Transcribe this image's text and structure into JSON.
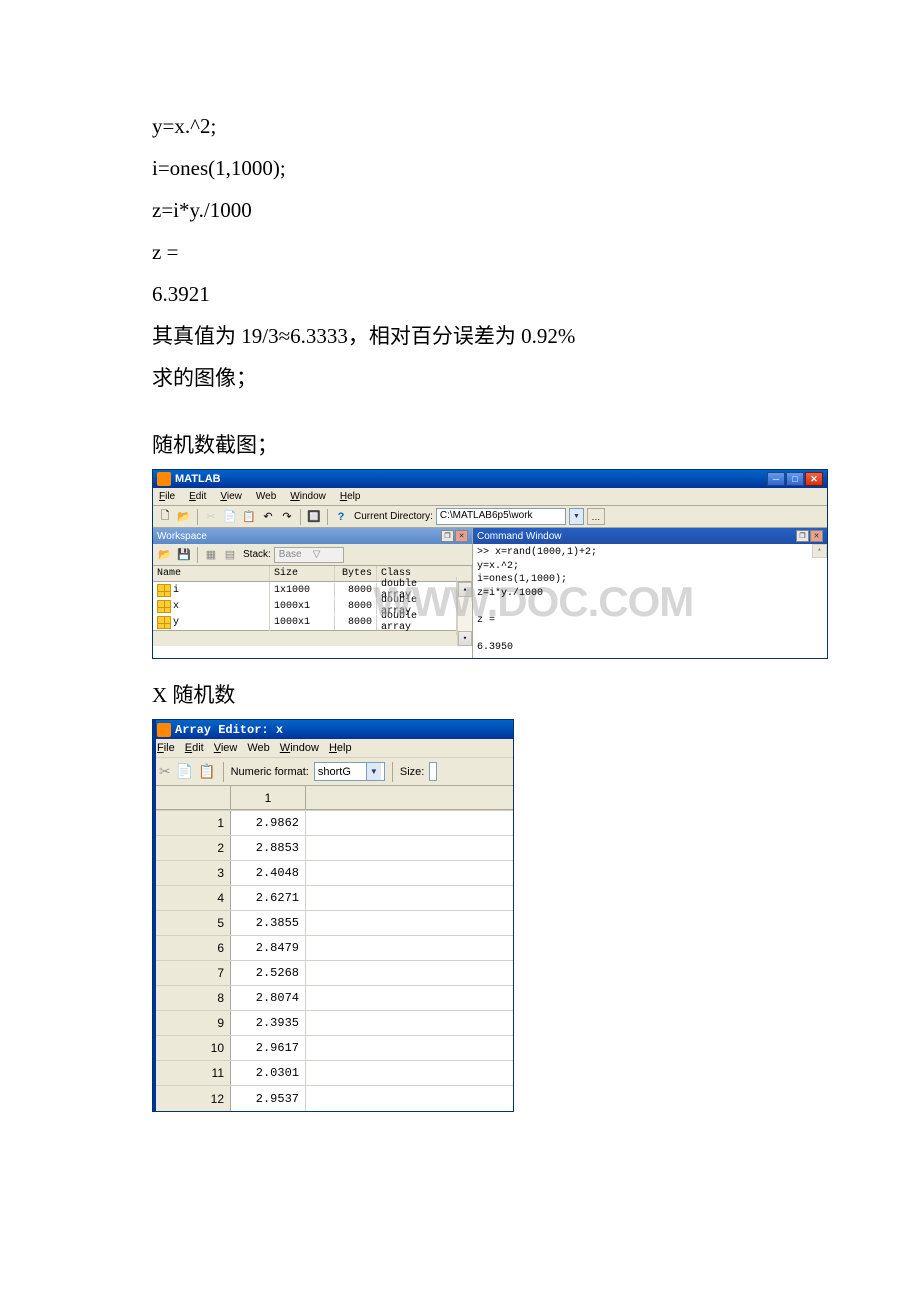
{
  "code": {
    "line1": "y=x.^2;",
    "line2": "i=ones(1,1000);",
    "line3": "z=i*y./1000",
    "line4": "z =",
    "line5": "6.3921",
    "line6": "其真值为 19/3≈6.3333，相对百分误差为 0.92%",
    "line7": "求的图像；"
  },
  "section1_title": "随机数截图；",
  "matlab": {
    "title": "MATLAB",
    "minimize": "─",
    "maximize": "□",
    "close": "✕",
    "menu": {
      "file": "File",
      "edit": "Edit",
      "view": "View",
      "web": "Web",
      "window": "Window",
      "help": "Help"
    },
    "toolbar": {
      "new": "🗋",
      "open": "📂",
      "cut": "✂",
      "copy": "📄",
      "paste": "📋",
      "undo": "↶",
      "redo": "↷",
      "simulink": "🔲",
      "help": "?",
      "dir_label": "Current Directory:",
      "dir_value": "C:\\MATLAB6p5\\work",
      "dropdown": "▼",
      "browse": "…"
    },
    "workspace": {
      "title": "Workspace",
      "dock": "❐",
      "close": "✕",
      "open_icon": "📂",
      "save_icon": "💾",
      "print_icon": "▦",
      "del_icon": "▤",
      "stack_label": "Stack:",
      "stack_value": "Base",
      "stack_arrow": "▽",
      "col_name": "Name",
      "col_size": "Size",
      "col_bytes": "Bytes",
      "col_class": "Class",
      "rows": [
        {
          "name": "i",
          "size": "1x1000",
          "bytes": "8000",
          "class": "double array"
        },
        {
          "name": "x",
          "size": "1000x1",
          "bytes": "8000",
          "class": "double array"
        },
        {
          "name": "y",
          "size": "1000x1",
          "bytes": "8000",
          "class": "double array"
        }
      ],
      "scroll_up": "▴",
      "scroll_down": "▾"
    },
    "command": {
      "title": "Command Window",
      "dock": "❐",
      "close": "✕",
      "scroll_up": "▴",
      "lines": [
        ">> x=rand(1000,1)+2;",
        "y=x.^2;",
        "i=ones(1,1000);",
        "z=i*y./1000",
        "",
        "z =",
        "",
        "    6.3950"
      ]
    },
    "watermark": "WWW.DOC.COM"
  },
  "section2_title": "X 随机数",
  "array_editor": {
    "title": "Array Editor: x",
    "menu": {
      "file": "File",
      "edit": "Edit",
      "view": "View",
      "web": "Web",
      "window": "Window",
      "help": "Help"
    },
    "toolbar": {
      "cut": "✂",
      "copy": "📄",
      "paste": "📋",
      "format_label": "Numeric format:",
      "format_value": "shortG",
      "dropdown": "▼",
      "size_label": "Size:"
    },
    "col_header": "1",
    "rows": [
      {
        "idx": "1",
        "val": "2.9862"
      },
      {
        "idx": "2",
        "val": "2.8853"
      },
      {
        "idx": "3",
        "val": "2.4048"
      },
      {
        "idx": "4",
        "val": "2.6271"
      },
      {
        "idx": "5",
        "val": "2.3855"
      },
      {
        "idx": "6",
        "val": "2.8479"
      },
      {
        "idx": "7",
        "val": "2.5268"
      },
      {
        "idx": "8",
        "val": "2.8074"
      },
      {
        "idx": "9",
        "val": "2.3935"
      },
      {
        "idx": "10",
        "val": "2.9617"
      },
      {
        "idx": "11",
        "val": "2.0301"
      },
      {
        "idx": "12",
        "val": "2.9537"
      }
    ]
  }
}
